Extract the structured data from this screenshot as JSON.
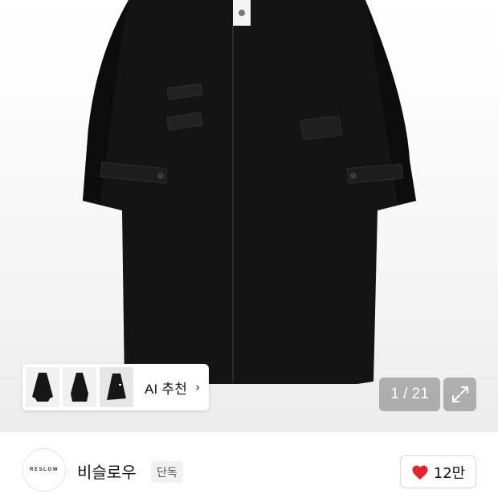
{
  "gallery": {
    "counter_text": "1 / 21",
    "expand_icon": "expand-arrows-icon"
  },
  "ai_recommend": {
    "label": "AI 추천",
    "chevron": "›",
    "thumbnails": [
      "coat-thumbnail-1",
      "coat-thumbnail-2",
      "coat-thumbnail-3"
    ]
  },
  "brand": {
    "logo_text": "RESLOW",
    "name": "비슬로우",
    "badge": "단독"
  },
  "like": {
    "icon": "heart-icon",
    "count": "12만",
    "color": "#e8222c"
  }
}
